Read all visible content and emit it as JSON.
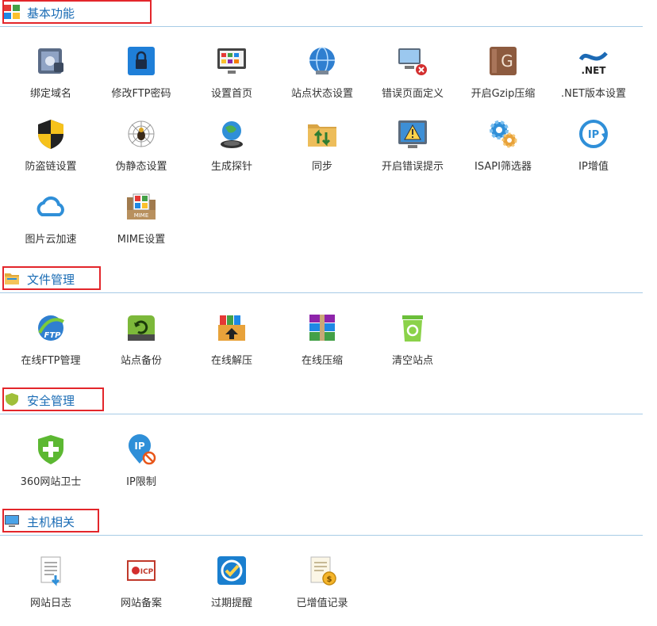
{
  "colors": {
    "accent": "#1a6cb5",
    "highlight_border": "#e3262b",
    "divider": "#a7cbe6"
  },
  "sections": [
    {
      "title": "基本功能",
      "icon": "grid-four-color-icon",
      "items": [
        {
          "label": "绑定域名",
          "icon": "domain-bind-icon"
        },
        {
          "label": "修改FTP密码",
          "icon": "lock-icon"
        },
        {
          "label": "设置首页",
          "icon": "homepage-icon"
        },
        {
          "label": "站点状态设置",
          "icon": "globe-status-icon"
        },
        {
          "label": "错误页面定义",
          "icon": "error-page-icon"
        },
        {
          "label": "开启Gzip压缩",
          "icon": "gzip-icon"
        },
        {
          "label": ".NET版本设置",
          "icon": "dotnet-icon"
        },
        {
          "label": "防盗链设置",
          "icon": "shield-icon"
        },
        {
          "label": "伪静态设置",
          "icon": "spider-icon"
        },
        {
          "label": "生成探针",
          "icon": "probe-icon"
        },
        {
          "label": "同步",
          "icon": "sync-folder-icon"
        },
        {
          "label": "开启错误提示",
          "icon": "warning-icon"
        },
        {
          "label": "ISAPI筛选器",
          "icon": "gears-icon"
        },
        {
          "label": "IP增值",
          "icon": "ip-refresh-icon"
        },
        {
          "label": "图片云加速",
          "icon": "cloud-icon"
        },
        {
          "label": "MIME设置",
          "icon": "mime-folder-icon"
        }
      ]
    },
    {
      "title": "文件管理",
      "icon": "folder-section-icon",
      "items": [
        {
          "label": "在线FTP管理",
          "icon": "ftp-globe-icon"
        },
        {
          "label": "站点备份",
          "icon": "backup-disk-icon"
        },
        {
          "label": "在线解压",
          "icon": "unzip-box-icon"
        },
        {
          "label": "在线压缩",
          "icon": "compress-box-icon"
        },
        {
          "label": "清空站点",
          "icon": "recycle-bin-icon"
        }
      ]
    },
    {
      "title": "安全管理",
      "icon": "shield-section-icon",
      "items": [
        {
          "label": "360网站卫士",
          "icon": "shield-plus-icon"
        },
        {
          "label": "IP限制",
          "icon": "ip-block-icon"
        }
      ]
    },
    {
      "title": "主机相关",
      "icon": "monitor-section-icon",
      "items": [
        {
          "label": "网站日志",
          "icon": "log-document-icon"
        },
        {
          "label": "网站备案",
          "icon": "icp-certificate-icon"
        },
        {
          "label": "过期提醒",
          "icon": "check-reminder-icon"
        },
        {
          "label": "已增值记录",
          "icon": "coin-record-icon"
        }
      ]
    }
  ]
}
